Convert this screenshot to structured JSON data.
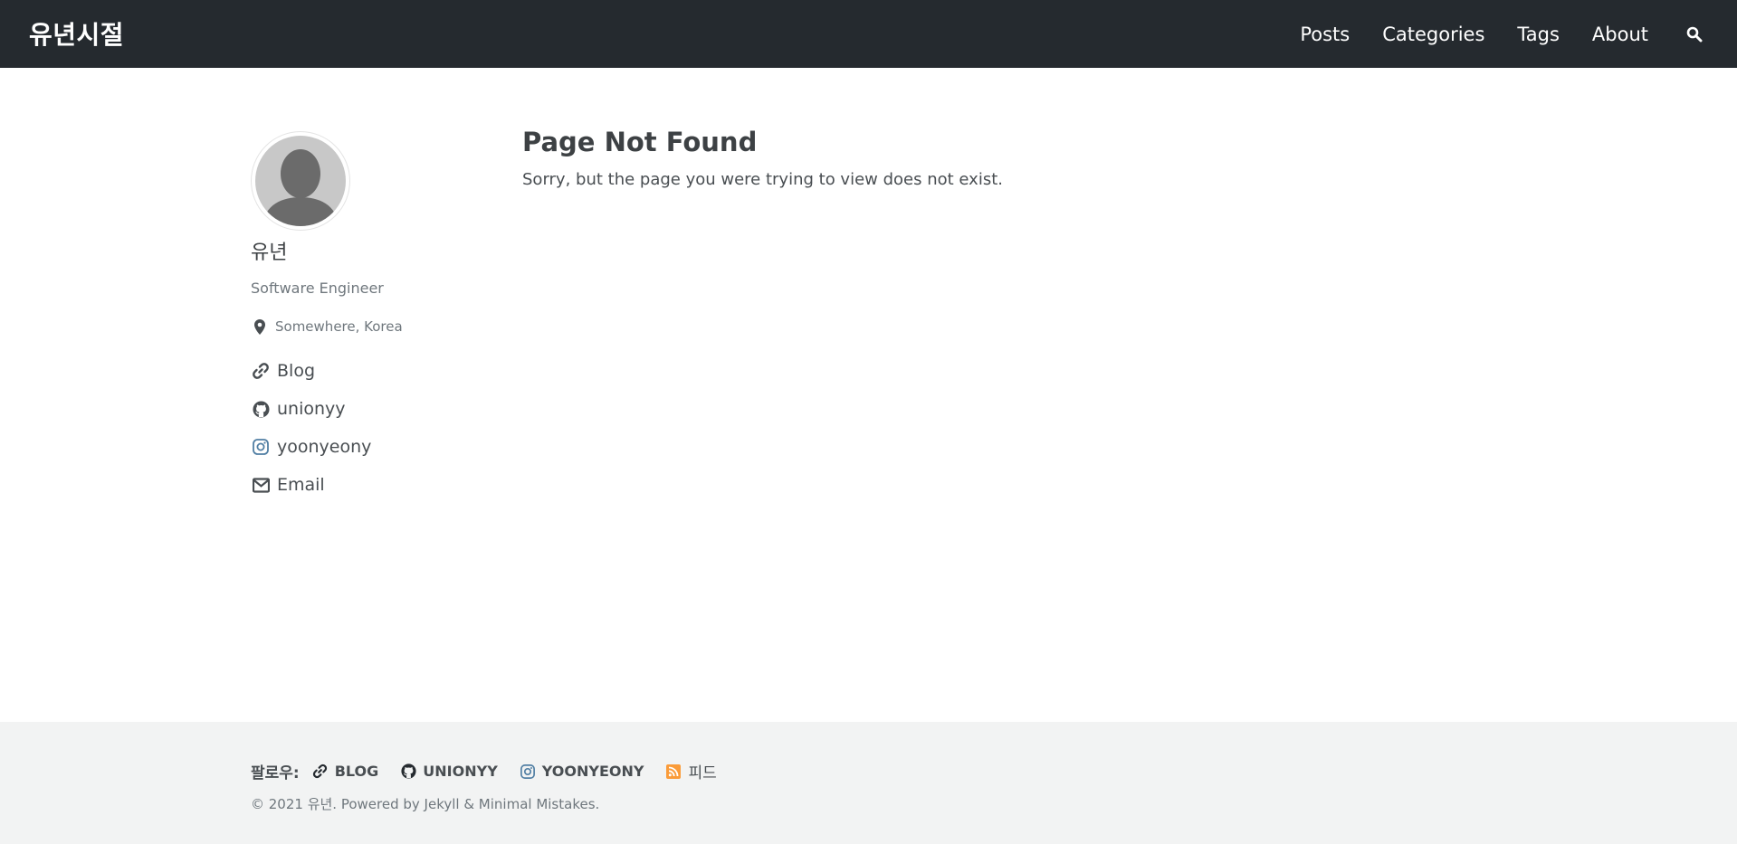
{
  "masthead": {
    "site_title": "유년시절",
    "nav": [
      "Posts",
      "Categories",
      "Tags",
      "About"
    ],
    "search_icon": "search-icon"
  },
  "author": {
    "name": "유년",
    "bio": "Software Engineer",
    "location": "Somewhere, Korea",
    "links": [
      {
        "label": "Blog",
        "icon": "link-icon"
      },
      {
        "label": "unionyy",
        "icon": "github-icon"
      },
      {
        "label": "yoonyeony",
        "icon": "instagram-icon"
      },
      {
        "label": "Email",
        "icon": "envelope-icon"
      }
    ]
  },
  "main": {
    "title": "Page Not Found",
    "message": "Sorry, but the page you were trying to view does not exist."
  },
  "footer": {
    "follow_label": "팔로우:",
    "follow_items": [
      {
        "label": "BLOG",
        "icon": "link-icon"
      },
      {
        "label": "UNIONYY",
        "icon": "github-icon"
      },
      {
        "label": "YOONYEONY",
        "icon": "instagram-icon"
      },
      {
        "label": "피드",
        "icon": "rss-icon"
      }
    ],
    "copyright": "© 2021 유년. Powered by Jekyll & Minimal Mistakes."
  },
  "colors": {
    "masthead_bg": "#252a2f",
    "footer_bg": "#f2f3f3",
    "instagram": "#517fa4",
    "rss": "#fa9b39"
  }
}
